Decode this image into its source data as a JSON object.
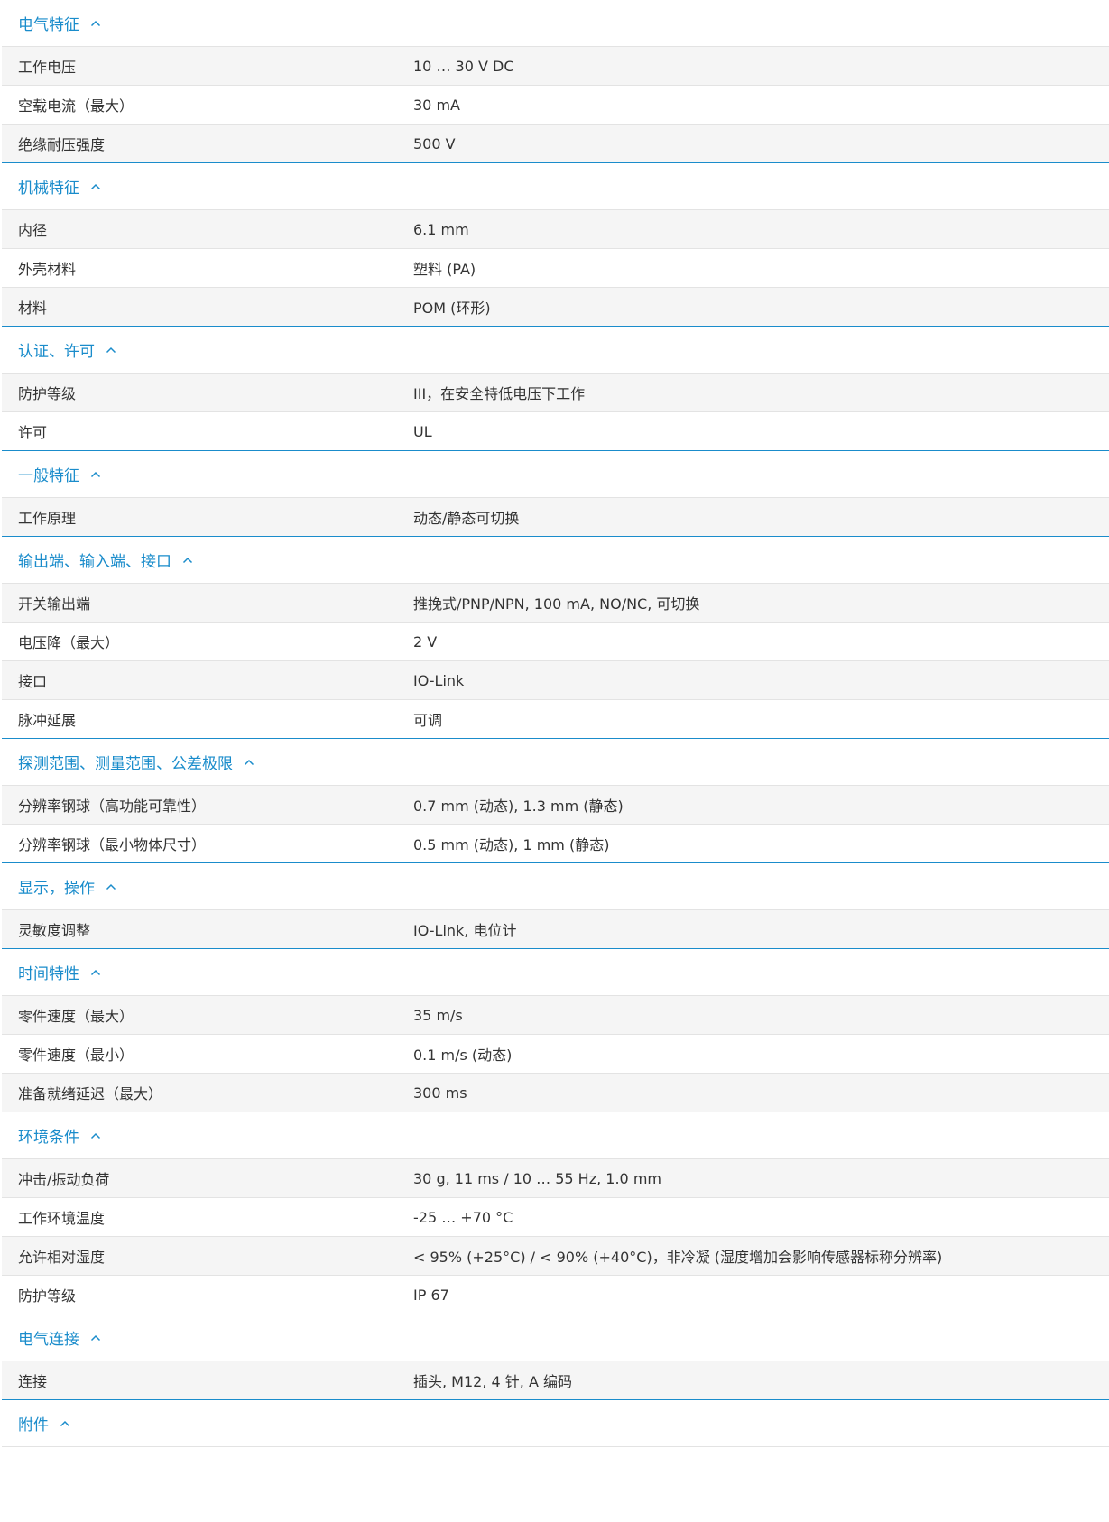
{
  "accent_color": "#1a8ccb",
  "sections": [
    {
      "title": "电气特征",
      "rows": [
        {
          "label": "工作电压",
          "value": "10 … 30 V DC"
        },
        {
          "label": "空载电流（最大）",
          "value": "30 mA"
        },
        {
          "label": "绝缘耐压强度",
          "value": "500 V"
        }
      ]
    },
    {
      "title": "机械特征",
      "rows": [
        {
          "label": "内径",
          "value": "6.1 mm"
        },
        {
          "label": "外壳材料",
          "value": "塑料 (PA)"
        },
        {
          "label": "材料",
          "value": "POM (环形)"
        }
      ]
    },
    {
      "title": "认证、许可",
      "rows": [
        {
          "label": "防护等级",
          "value": "III，在安全特低电压下工作"
        },
        {
          "label": "许可",
          "value": "UL"
        }
      ]
    },
    {
      "title": "一般特征",
      "rows": [
        {
          "label": "工作原理",
          "value": "动态/静态可切换"
        }
      ]
    },
    {
      "title": "输出端、输入端、接口",
      "rows": [
        {
          "label": "开关输出端",
          "value": "推挽式/PNP/NPN, 100 mA, NO/NC, 可切换"
        },
        {
          "label": "电压降（最大）",
          "value": "2 V"
        },
        {
          "label": "接口",
          "value": "IO-Link"
        },
        {
          "label": "脉冲延展",
          "value": "可调"
        }
      ]
    },
    {
      "title": "探测范围、测量范围、公差极限",
      "rows": [
        {
          "label": "分辨率钢球（高功能可靠性）",
          "value": "0.7 mm (动态), 1.3 mm (静态)"
        },
        {
          "label": "分辨率钢球（最小物体尺寸）",
          "value": "0.5 mm (动态), 1 mm (静态)"
        }
      ]
    },
    {
      "title": "显示，操作",
      "rows": [
        {
          "label": "灵敏度调整",
          "value": "IO-Link, 电位计"
        }
      ]
    },
    {
      "title": "时间特性",
      "rows": [
        {
          "label": "零件速度（最大）",
          "value": "35 m/s"
        },
        {
          "label": "零件速度（最小）",
          "value": "0.1 m/s (动态)"
        },
        {
          "label": "准备就绪延迟（最大）",
          "value": "300 ms"
        }
      ]
    },
    {
      "title": "环境条件",
      "rows": [
        {
          "label": "冲击/振动负荷",
          "value": "30 g, 11 ms / 10 … 55 Hz, 1.0 mm"
        },
        {
          "label": "工作环境温度",
          "value": "-25 … +70 °C"
        },
        {
          "label": "允许相对湿度",
          "value": "< 95% (+25°C) / < 90% (+40°C)，非冷凝 (湿度增加会影响传感器标称分辨率)"
        },
        {
          "label": "防护等级",
          "value": "IP 67"
        }
      ]
    },
    {
      "title": "电气连接",
      "rows": [
        {
          "label": "连接",
          "value": "插头, M12, 4 针, A 编码"
        }
      ]
    },
    {
      "title": "附件",
      "rows": []
    }
  ]
}
